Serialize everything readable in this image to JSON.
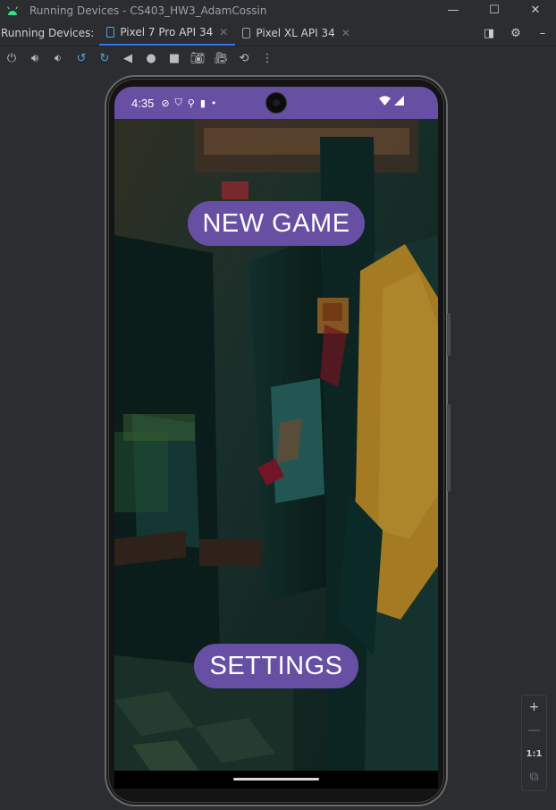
{
  "window": {
    "title": "Running Devices - CS403_HW3_AdamCossin",
    "controls": [
      "—",
      "☐",
      "✕"
    ]
  },
  "tabs": {
    "label": "Running Devices:",
    "items": [
      {
        "label": "Pixel 7 Pro API 34",
        "active": true
      },
      {
        "label": "Pixel XL API 34",
        "active": false
      }
    ],
    "close_glyph": "✕"
  },
  "toolbar": {
    "icons": [
      "power-icon",
      "volume-up-icon",
      "volume-down-icon",
      "rotate-left-icon",
      "rotate-right-icon",
      "back-icon",
      "home-icon",
      "overview-icon",
      "screenshot-icon",
      "screen-record-icon",
      "reset-icon",
      "more-icon"
    ]
  },
  "device": {
    "status_bar": {
      "time": "4:35",
      "color": "#6750a4"
    },
    "buttons": {
      "new_game": "NEW GAME",
      "settings": "SETTINGS"
    },
    "accent": "#6750a4"
  },
  "zoom": {
    "zoom_in": "+",
    "zoom_out": "—",
    "actual_size": "1:1"
  }
}
